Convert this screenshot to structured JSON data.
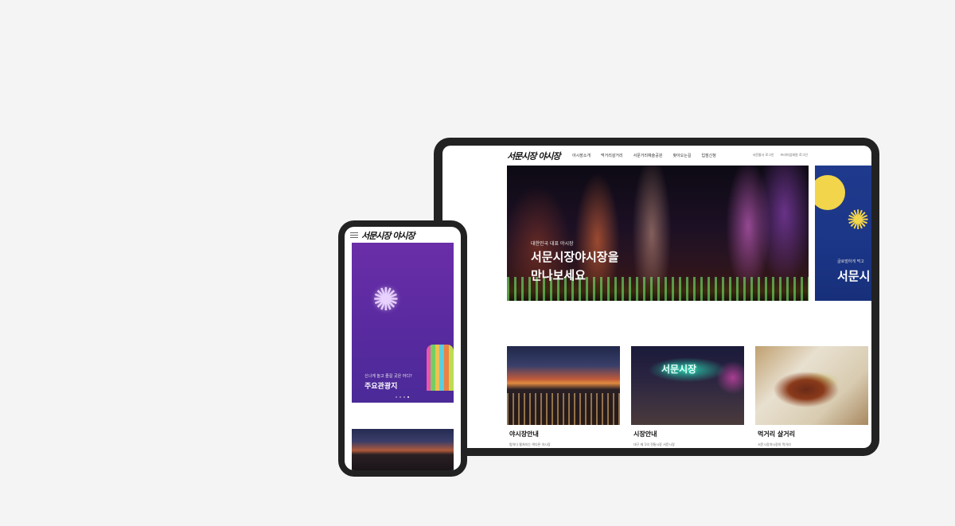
{
  "logo": {
    "text": "서문시장 야시장"
  },
  "tablet": {
    "nav": [
      "야시장소개",
      "먹거리살거리",
      "서문거리예술공원",
      "찾아오는길",
      "입점신청"
    ],
    "util": [
      "서문몰사 로그인",
      "프리미엄회원 로그인"
    ],
    "hero": {
      "subtitle": "대한민국 대표 야시장",
      "title_line1": "서문시장야시장을",
      "title_line2": "만나보세요"
    },
    "hero_next": {
      "subtitle": "글로벌하게 먹고",
      "title": "서문시"
    },
    "cards": [
      {
        "title": "야시장안내",
        "desc": "밤하다 펼쳐지는 색다른 야시장"
      },
      {
        "title": "시장안내",
        "desc": "대구 제 1의 전통시장 서문시장"
      },
      {
        "title": "먹거리 살거리",
        "desc": "서문시장야시장의 먹거리"
      }
    ],
    "market_sign": "서문시장"
  },
  "phone": {
    "banner": {
      "subtitle": "신나게 놀고 즐길 곳은 어디?",
      "title": "주요관광지"
    }
  },
  "icons": {
    "menu": "hamburger-icon",
    "firework": "firework-icon"
  },
  "colors": {
    "device_frame": "#222222",
    "background": "#f4f4f4",
    "banner_purple": "#5a2aa0",
    "banner_blue": "#1f3a8c"
  }
}
